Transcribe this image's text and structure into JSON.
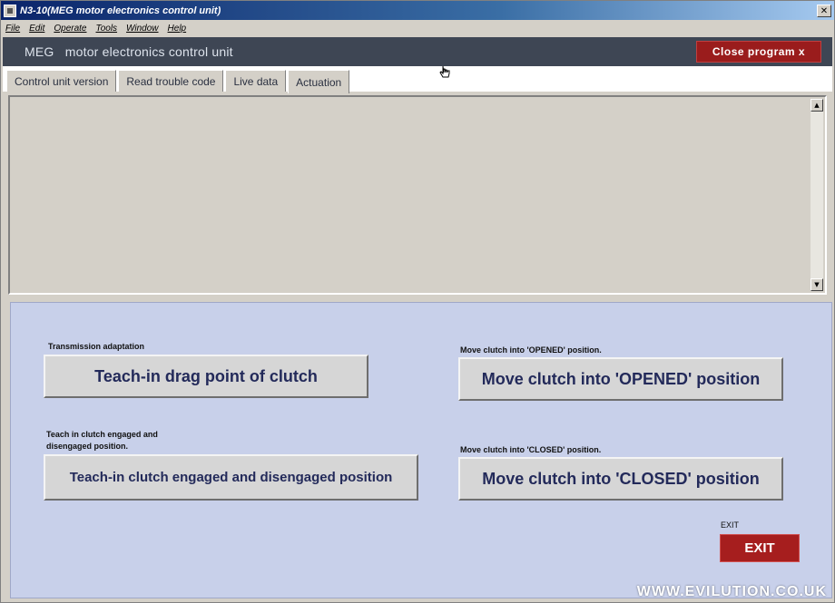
{
  "window": {
    "title": "N3-10(MEG motor electronics control unit)",
    "close_glyph": "✕"
  },
  "menu": [
    "File",
    "Edit",
    "Operate",
    "Tools",
    "Window",
    "Help"
  ],
  "header": {
    "title": "MEG   motor electronics control unit",
    "close_program_label": "Close program x"
  },
  "tabs": [
    {
      "label": "Control unit version",
      "active": false
    },
    {
      "label": "Read trouble code",
      "active": false
    },
    {
      "label": "Live data",
      "active": false
    },
    {
      "label": "Actuation",
      "active": true
    }
  ],
  "scroll": {
    "up": "▲",
    "down": "▼"
  },
  "actions": {
    "teach_drag": {
      "caption": "Transmission adaptation",
      "label": "Teach-in drag point of clutch"
    },
    "teach_engaged": {
      "caption_line1": "Teach in clutch engaged and",
      "caption_line2": "disengaged position.",
      "label": "Teach-in clutch engaged and disengaged position"
    },
    "move_opened": {
      "caption": "Move clutch into 'OPENED' position.",
      "label": "Move clutch into 'OPENED' position"
    },
    "move_closed": {
      "caption": "Move clutch into 'CLOSED' position.",
      "label": "Move clutch into 'CLOSED' position"
    },
    "exit": {
      "caption": "EXIT",
      "label": "EXIT"
    }
  },
  "watermark": "WWW.EVILUTION.CO.UK",
  "colors": {
    "header_bg": "#3e4654",
    "close_program_bg": "#9a1c1c",
    "action_area_bg": "#c8d0ea",
    "button_text": "#232a5a",
    "exit_bg": "#a61e1e"
  }
}
